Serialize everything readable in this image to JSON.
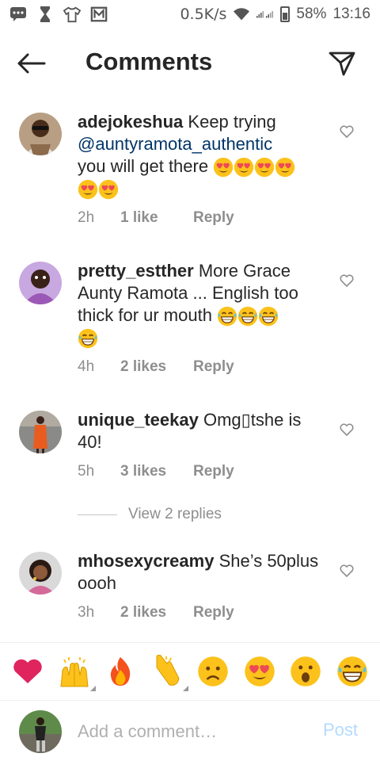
{
  "status_bar": {
    "speed": "0.5K/s",
    "battery": "58%",
    "time": "13:16",
    "icons": [
      "chat-icon",
      "hourglass-icon",
      "tshirt-icon",
      "mail-icon",
      "wifi-icon",
      "signal-icon",
      "battery-icon"
    ]
  },
  "header": {
    "title": "Comments",
    "back_icon": "arrow-left-icon",
    "send_icon": "paper-plane-icon"
  },
  "comments": [
    {
      "username": "adejokeshua",
      "text": "Keep trying",
      "mention": "@auntyramota_authentic",
      "text_after": "you will get there",
      "emojis": [
        "heart-eyes",
        "heart-eyes",
        "heart-eyes",
        "heart-eyes",
        "heart-eyes",
        "heart-eyes"
      ],
      "time": "2h",
      "likes": "1 like",
      "reply": "Reply"
    },
    {
      "username": "pretty_estther",
      "text": "More Grace Aunty Ramota ... English too thick for ur mouth",
      "emojis": [
        "grin-sweat",
        "grin-sweat",
        "grin-sweat",
        "grin-sweat"
      ],
      "time": "4h",
      "likes": "2 likes",
      "reply": "Reply"
    },
    {
      "username": "unique_teekay",
      "text": "Omg▯tshe is 40!",
      "time": "5h",
      "likes": "3 likes",
      "reply": "Reply"
    },
    {
      "username": "mhosexycreamy",
      "text": "She’s 50plus oooh",
      "time": "3h",
      "likes": "2 likes",
      "reply": "Reply"
    }
  ],
  "view_replies": "View 2 replies",
  "reactions": [
    "red-heart",
    "raising-hands",
    "fire",
    "clapping-hands",
    "sad-face",
    "heart-eyes",
    "surprised-face",
    "grin-sweat"
  ],
  "comment_input": {
    "placeholder": "Add a comment…",
    "post_label": "Post"
  },
  "colors": {
    "mention": "#003569",
    "meta": "#8e8e8e",
    "post_disabled": "#b3dbff",
    "heart": "#ed4956",
    "emoji_yellow": "#fcc21b"
  }
}
